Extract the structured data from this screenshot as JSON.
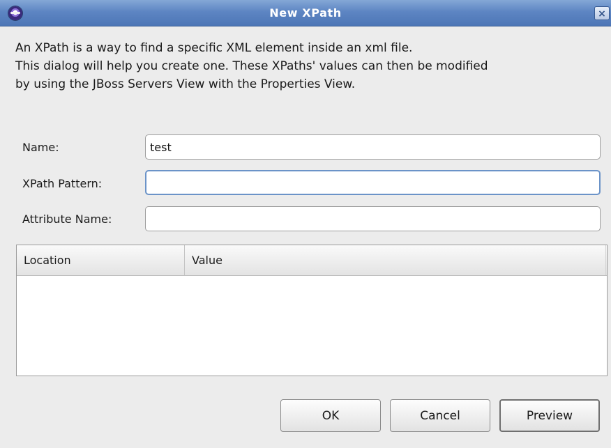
{
  "window": {
    "title": "New XPath",
    "close_label": "×"
  },
  "description": "An XPath is a way to find a specific XML element inside an xml file.\nThis dialog will help you create one. These XPaths' values can then be modified\nby using the JBoss Servers View with the Properties View.",
  "form": {
    "name_label": "Name:",
    "name_value": "test",
    "xpath_label": "XPath Pattern:",
    "xpath_value": "",
    "attribute_label": "Attribute Name:",
    "attribute_value": ""
  },
  "table": {
    "columns": [
      "Location",
      "Value"
    ],
    "rows": []
  },
  "buttons": {
    "ok": "OK",
    "cancel": "Cancel",
    "preview": "Preview"
  }
}
